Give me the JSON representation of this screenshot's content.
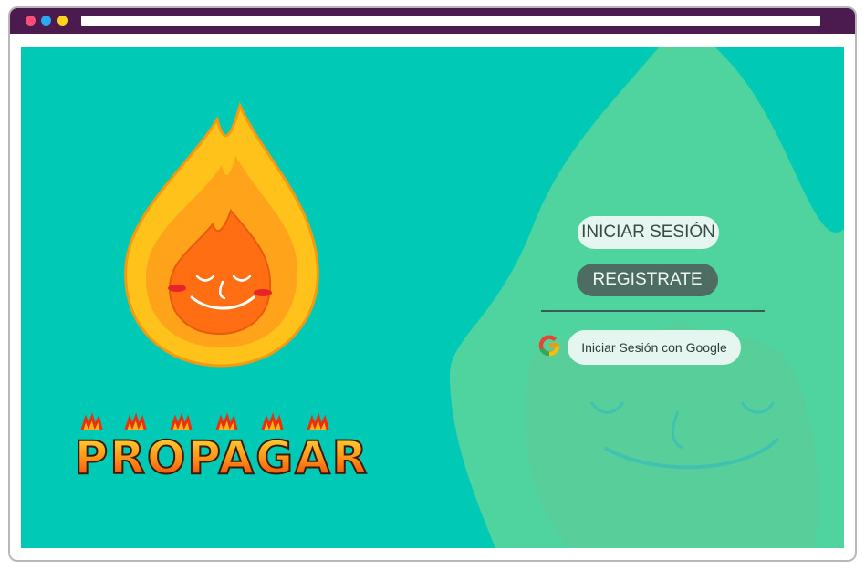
{
  "browser": {
    "window_controls": [
      "close",
      "minimize",
      "maximize"
    ],
    "address_value": ""
  },
  "brand": {
    "logo_text": "PROPAGAR"
  },
  "auth": {
    "login_label": "INICIAR SESIÓN",
    "register_label": "REGISTRATE",
    "google_label": "Iniciar Sesión con Google"
  },
  "colors": {
    "page_background": "#00c9b5",
    "flame_shape": "#4fd49f",
    "titlebar": "#4b1a4f",
    "register_button": "#4d6d62",
    "light_button": "#e4f6ef"
  }
}
